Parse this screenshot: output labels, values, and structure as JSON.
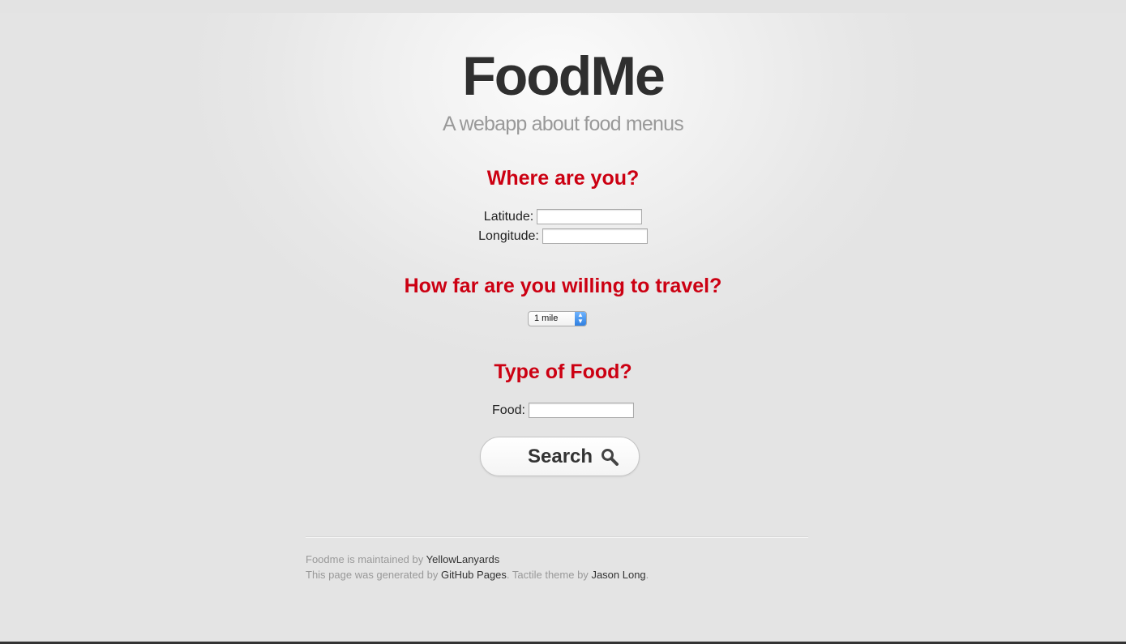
{
  "header": {
    "title": "FoodMe",
    "subtitle": "A webapp about food menus"
  },
  "location": {
    "heading": "Where are you?",
    "latitude_label": "Latitude:",
    "latitude_value": "",
    "longitude_label": "Longitude:",
    "longitude_value": ""
  },
  "distance": {
    "heading": "How far are you willing to travel?",
    "selected": "1 mile"
  },
  "food": {
    "heading": "Type of Food?",
    "label": "Food:",
    "value": ""
  },
  "search": {
    "label": "Search",
    "icon": "search-icon"
  },
  "footer": {
    "line1_prefix": "Foodme is maintained by",
    "maintainer_link": "YellowLanyards",
    "line2_prefix": "This page was generated by",
    "pages_link": "GitHub Pages",
    "line2_middle": ". Tactile theme by",
    "author_link": "Jason Long",
    "line2_suffix": "."
  },
  "colors": {
    "heading": "#cc0012",
    "title": "#2f2f2f",
    "subtitle": "#999999"
  }
}
